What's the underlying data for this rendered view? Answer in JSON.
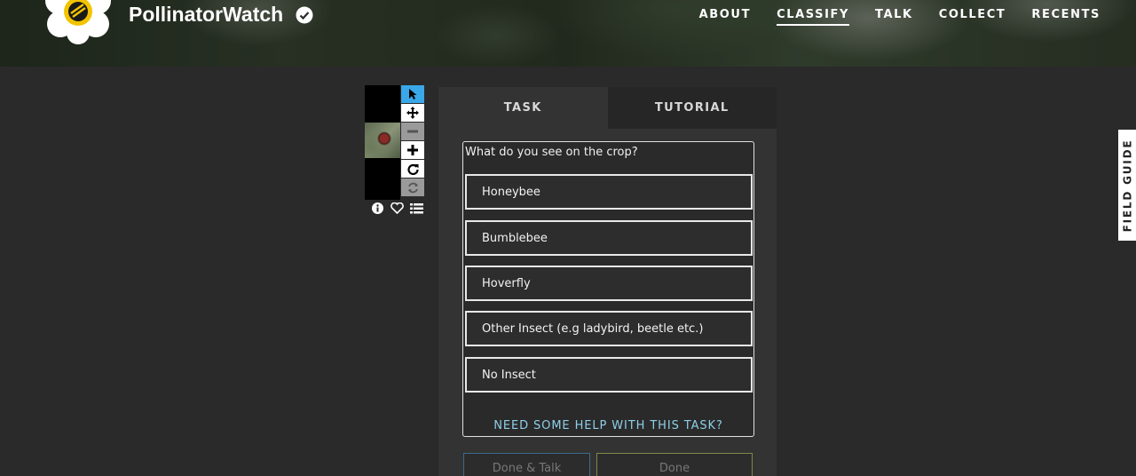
{
  "brand": {
    "name": "PollinatorWatch"
  },
  "nav": {
    "items": [
      "ABOUT",
      "CLASSIFY",
      "TALK",
      "COLLECT",
      "RECENTS"
    ],
    "active": "CLASSIFY"
  },
  "tabs": {
    "task": "TASK",
    "tutorial": "TUTORIAL"
  },
  "task": {
    "question": "What do you see on the crop?",
    "answers": [
      "Honeybee",
      "Bumblebee",
      "Hoverfly",
      "Other Insect (e.g ladybird, beetle etc.)",
      "No Insect"
    ],
    "help": "NEED SOME HELP WITH THIS TASK?"
  },
  "buttons": {
    "done_talk": "Done & Talk",
    "done": "Done"
  },
  "field_guide": "FIELD GUIDE",
  "tools": [
    "pointer-icon",
    "move-icon",
    "zoom-out-icon",
    "zoom-in-icon",
    "rotate-icon",
    "reset-icon"
  ],
  "colors": {
    "tool_selected": "#3aa7e8",
    "help_link": "#8fcfe8",
    "talk_border": "#3e6a8a",
    "done_border": "#7a8a4a"
  }
}
